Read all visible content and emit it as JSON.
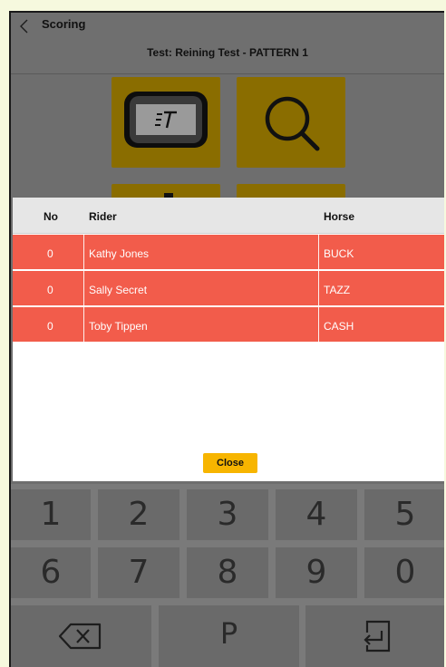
{
  "header": {
    "title": "Scoring",
    "subtitle": "Test: Reining Test - PATTERN 1"
  },
  "tiles": {
    "et_logo_text": "ET",
    "search_icon": "search-icon"
  },
  "modal": {
    "columns": {
      "no": "No",
      "rider": "Rider",
      "horse": "Horse"
    },
    "rows": [
      {
        "no": "0",
        "rider": "Kathy Jones",
        "horse": "BUCK"
      },
      {
        "no": "0",
        "rider": "Sally Secret",
        "horse": "TAZZ"
      },
      {
        "no": "0",
        "rider": "Toby Tippen",
        "horse": "CASH"
      }
    ],
    "close_label": "Close",
    "row_color": "#f25c4b",
    "button_color": "#f7b500"
  },
  "keypad": {
    "row1": [
      "1",
      "2",
      "3",
      "4",
      "5"
    ],
    "row2": [
      "6",
      "7",
      "8",
      "9",
      "0"
    ],
    "row3": {
      "backspace_icon": "backspace-icon",
      "p_label": "P",
      "enter_icon": "enter-icon"
    }
  }
}
